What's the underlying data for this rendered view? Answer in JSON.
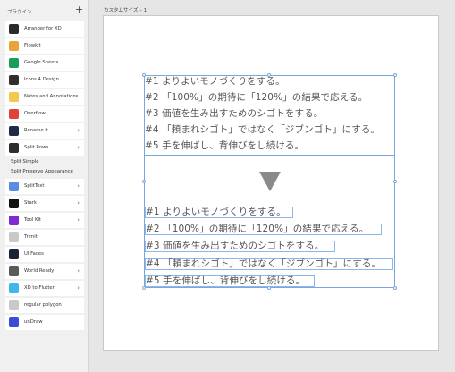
{
  "panel": {
    "title": "プラグイン",
    "add_label": "+"
  },
  "plugins": [
    {
      "label": "Arranger for XD",
      "icon": "arranger-icon",
      "color": "#2b2b2b",
      "chevron": false
    },
    {
      "label": "Flowkit",
      "icon": "flowkit-icon",
      "color": "#e8a33b",
      "chevron": false
    },
    {
      "label": "Google Sheets",
      "icon": "sheets-icon",
      "color": "#1a9c5b",
      "chevron": false
    },
    {
      "label": "Icons 4 Design",
      "icon": "icons4design-icon",
      "color": "#2f2f2f",
      "chevron": false
    },
    {
      "label": "Notes and Annotations",
      "icon": "notes-icon",
      "color": "#f2c94c",
      "chevron": false
    },
    {
      "label": "Overflow",
      "icon": "overflow-icon",
      "color": "#e0413b",
      "chevron": false
    },
    {
      "label": "Rename it",
      "icon": "renameit-icon",
      "color": "#1f2a4a",
      "chevron": true
    },
    {
      "label": "Split Rows",
      "icon": "splitrows-icon",
      "color": "#2d2d2d",
      "chevron": true
    }
  ],
  "split_rows_submenu": [
    "Split Simple",
    "Split Preserve Appearance"
  ],
  "plugins_2": [
    {
      "label": "SplitText",
      "icon": "splittext-icon",
      "color": "#5b8de6",
      "chevron": true
    },
    {
      "label": "Stark",
      "icon": "stark-icon",
      "color": "#111111",
      "chevron": true
    },
    {
      "label": "Tool Kit",
      "icon": "toolkit-icon",
      "color": "#7c2bd6",
      "chevron": true
    },
    {
      "label": "Trimit",
      "icon": "trimit-icon",
      "color": "#c9c9c9",
      "chevron": false
    },
    {
      "label": "UI Faces",
      "icon": "uifaces-icon",
      "color": "#1c2233",
      "chevron": false
    },
    {
      "label": "World Ready",
      "icon": "worldready-icon",
      "color": "#5a5a5a",
      "chevron": true
    },
    {
      "label": "XD to Flutter",
      "icon": "flutter-icon",
      "color": "#3fb6f0",
      "chevron": true
    },
    {
      "label": "regular polygon",
      "icon": "polygon-icon",
      "color": "#c9c9c9",
      "chevron": false
    },
    {
      "label": "unDraw",
      "icon": "undraw-icon",
      "color": "#3a4dd8",
      "chevron": false
    }
  ],
  "artboard": {
    "label": "カスタムサイズ – 1"
  },
  "text_lines": [
    "#1 よりよいモノづくりをする。",
    "#2 「100%」の期待に「120%」の結果で応える。",
    "#3 価値を生み出すためのシゴトをする。",
    "#4 「頼まれシゴト」ではなく「ジブンゴト」にする。",
    "#5 手を伸ばし、背伸びをし続ける。"
  ]
}
